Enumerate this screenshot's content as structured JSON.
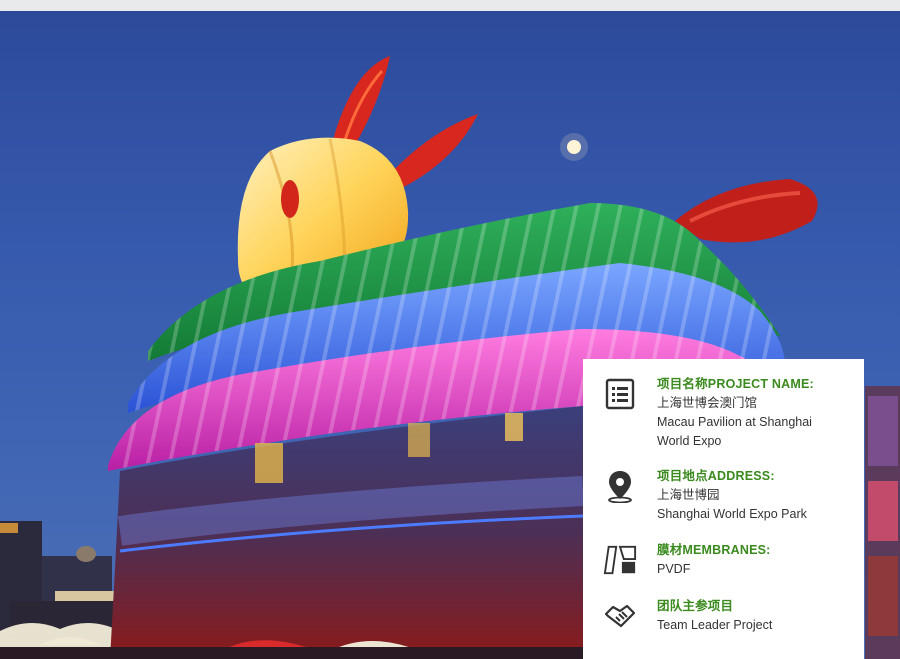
{
  "photo": {
    "subject": "Macau Pavilion rabbit lantern at night",
    "sky_color": "#3659ad"
  },
  "info": {
    "project_name": {
      "icon": "list-icon",
      "label": "项目名称PROJECT NAME:",
      "value_lines": [
        "上海世博会澳门馆",
        "Macau Pavilion at Shanghai",
        "World Expo"
      ]
    },
    "address": {
      "icon": "location-pin-icon",
      "label": "项目地点ADDRESS:",
      "value_lines": [
        "上海世博园",
        "Shanghai World Expo Park"
      ]
    },
    "membranes": {
      "icon": "membrane-panels-icon",
      "label": "膜材MEMBRANES:",
      "value_lines": [
        "PVDF"
      ]
    },
    "team": {
      "icon": "handshake-icon",
      "label": "团队主参项目",
      "value_lines": [
        "Team Leader Project"
      ]
    },
    "accent_color": "#3a8a1d",
    "text_color": "#333333"
  }
}
